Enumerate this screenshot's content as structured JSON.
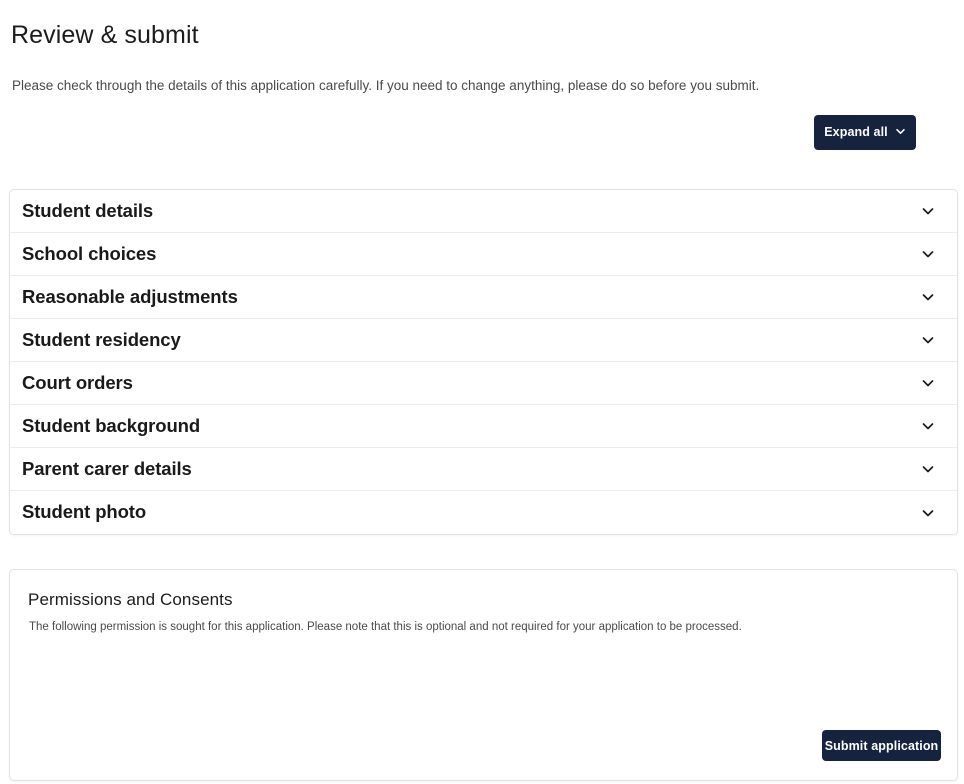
{
  "page": {
    "title": "Review & submit",
    "intro": "Please check through the details of this application carefully. If you need to change anything, please do so before you submit."
  },
  "toolbar": {
    "expand_all_label": "Expand all",
    "expand_all_icon": "chevron-down-icon"
  },
  "accordion": {
    "sections": [
      {
        "label": "Student details",
        "icon": "chevron-down-icon"
      },
      {
        "label": "School choices",
        "icon": "chevron-down-icon"
      },
      {
        "label": "Reasonable adjustments",
        "icon": "chevron-down-icon"
      },
      {
        "label": "Student residency",
        "icon": "chevron-down-icon"
      },
      {
        "label": "Court orders",
        "icon": "chevron-down-icon"
      },
      {
        "label": "Student background",
        "icon": "chevron-down-icon"
      },
      {
        "label": "Parent carer details",
        "icon": "chevron-down-icon"
      },
      {
        "label": "Student photo",
        "icon": "chevron-down-icon"
      }
    ]
  },
  "permissions": {
    "title": "Permissions and Consents",
    "description": "The following permission is sought for this application. Please note that this is optional and not required for your application to be processed.",
    "submit_label": "Submit application"
  },
  "colors": {
    "accent": "#16233f",
    "page_background": "#ffffff",
    "card_border": "#e2e2e2",
    "row_divider": "#ededed",
    "body_text": "#4a4a4a",
    "heading_text": "#1a1a1a"
  }
}
